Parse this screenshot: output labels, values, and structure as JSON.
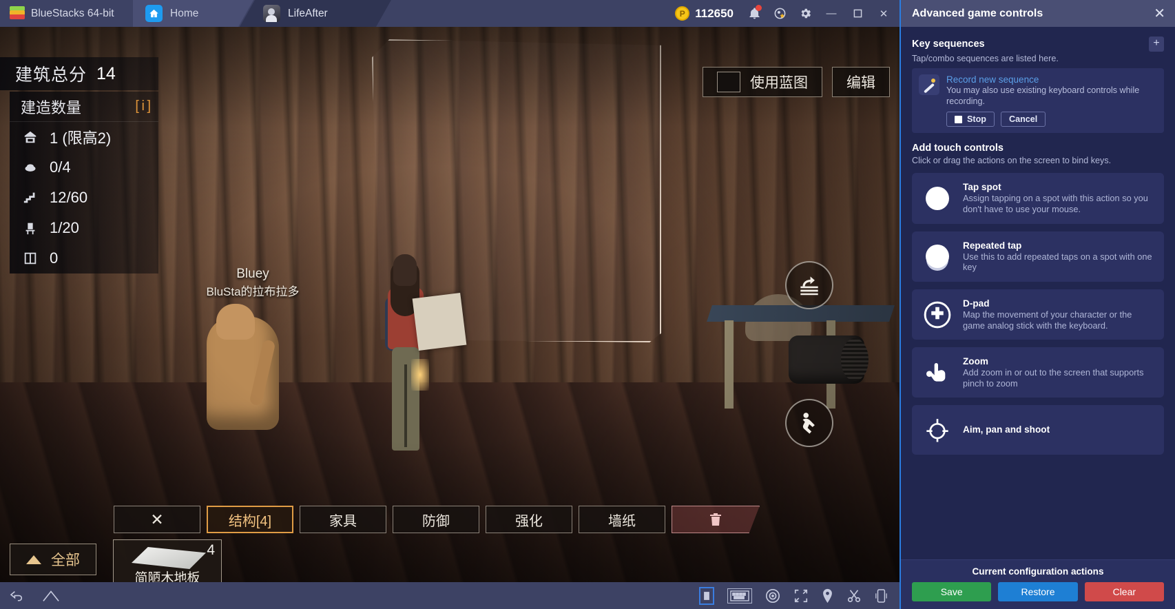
{
  "titlebar": {
    "brand": "BlueStacks 64-bit",
    "tabs": [
      {
        "label": "Home",
        "icon": "home-icon",
        "active": false
      },
      {
        "label": "LifeAfter",
        "icon": "app-avatar",
        "active": true
      }
    ],
    "coins": {
      "value": "112650",
      "icon": "points-coin-icon"
    },
    "icons": [
      "bell-icon",
      "rewards-icon",
      "gear-icon"
    ],
    "window_controls": {
      "minimize": "—",
      "maximize": "❐",
      "close": "✕"
    }
  },
  "game": {
    "score": {
      "label": "建筑总分",
      "value": "14"
    },
    "panel_header": {
      "label": "建造数量",
      "info": "[ i ]"
    },
    "stats": [
      {
        "icon": "house-icon",
        "value": "1 (限高2)"
      },
      {
        "icon": "stone-icon",
        "value": "0/4"
      },
      {
        "icon": "stairs-icon",
        "value": "12/60"
      },
      {
        "icon": "chair-icon",
        "value": "1/20"
      },
      {
        "icon": "window-icon",
        "value": "0"
      }
    ],
    "top_buttons": [
      {
        "label": "使用蓝图"
      },
      {
        "label": "编辑"
      }
    ],
    "side_buttons": [
      {
        "icon": "undo-layers-icon"
      },
      {
        "icon": "crouch-icon"
      }
    ],
    "pet": {
      "name": "Bluey",
      "owner": "BluSta的拉布拉多"
    },
    "toolbar": [
      {
        "label": "✕",
        "kind": "close",
        "selected": false
      },
      {
        "label": "结构[4]",
        "kind": "tab",
        "selected": true
      },
      {
        "label": "家具",
        "kind": "tab",
        "selected": false
      },
      {
        "label": "防御",
        "kind": "tab",
        "selected": false
      },
      {
        "label": "强化",
        "kind": "tab",
        "selected": false
      },
      {
        "label": "墙纸",
        "kind": "tab",
        "selected": false
      },
      {
        "label": "",
        "kind": "trash",
        "selected": false
      }
    ],
    "filter_button": {
      "label": "全部",
      "icon": "triangle-icon"
    },
    "item_slot": {
      "name": "简陋木地板",
      "qty": "4",
      "icon": "wood-floor-icon"
    }
  },
  "bottombar": {
    "left_icons": [
      "back-icon",
      "home-icon"
    ],
    "right_icons": [
      "volume-icon",
      "keyboard-icon",
      "eye-icon",
      "fullscreen-icon",
      "location-icon",
      "scissors-icon",
      "tilt-icon"
    ]
  },
  "panel": {
    "title": "Advanced game controls",
    "close": "✕",
    "key_sequences": {
      "heading": "Key sequences",
      "add": "+",
      "subtitle": "Tap/combo sequences are listed here.",
      "record_link": "Record new sequence",
      "record_desc": "You may also use existing keyboard controls while recording.",
      "stop": "Stop",
      "cancel": "Cancel"
    },
    "touch_controls": {
      "heading": "Add touch controls",
      "subtitle": "Click or drag the actions on the screen to bind keys.",
      "items": [
        {
          "icon": "tap-spot-icon",
          "title": "Tap spot",
          "desc": "Assign tapping on a spot with this action so you don't have to use your mouse."
        },
        {
          "icon": "repeated-tap-icon",
          "title": "Repeated tap",
          "desc": "Use this to add repeated taps on a spot with one key"
        },
        {
          "icon": "dpad-icon",
          "title": "D-pad",
          "desc": "Map the movement of your character or the game analog stick with the keyboard."
        },
        {
          "icon": "zoom-pinch-icon",
          "title": "Zoom",
          "desc": "Add zoom in or out to the screen that supports pinch to zoom"
        },
        {
          "icon": "aim-pan-shoot-icon",
          "title": "Aim, pan and shoot",
          "desc": ""
        }
      ]
    },
    "footer": {
      "heading": "Current configuration actions",
      "buttons": [
        {
          "label": "Save",
          "color": "#2e9e4f"
        },
        {
          "label": "Restore",
          "color": "#1e7fd4"
        },
        {
          "label": "Clear",
          "color": "#d04a4a"
        }
      ]
    }
  }
}
